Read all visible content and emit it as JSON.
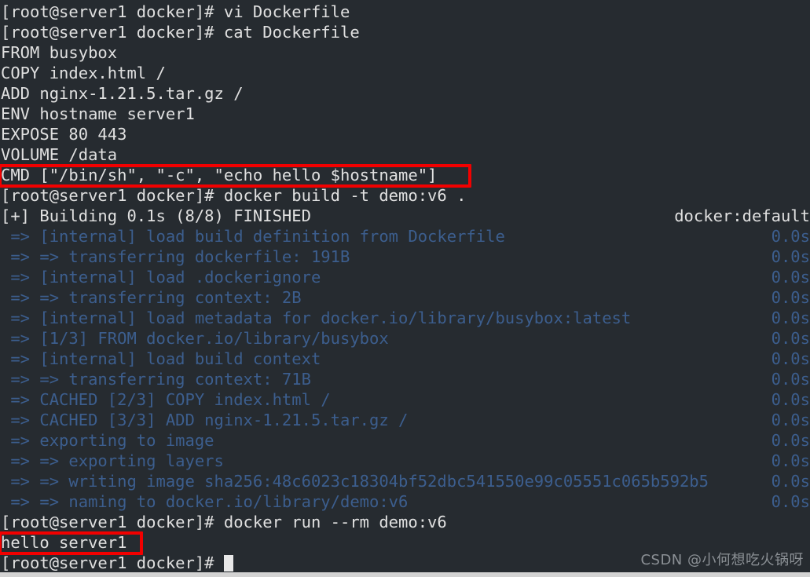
{
  "terminal": {
    "background_color": "#262b30",
    "foreground_color": "#e0e0e0",
    "build_output_color": "#3c5e8e",
    "highlight_color": "#f20000",
    "prompt": "[root@server1 docker]# ",
    "lines": [
      {
        "text": "[root@server1 docker]# vi Dockerfile",
        "color": "white",
        "duration": ""
      },
      {
        "text": "[root@server1 docker]# cat Dockerfile",
        "color": "white",
        "duration": ""
      },
      {
        "text": "FROM busybox",
        "color": "white",
        "duration": ""
      },
      {
        "text": "COPY index.html /",
        "color": "white",
        "duration": ""
      },
      {
        "text": "ADD nginx-1.21.5.tar.gz /",
        "color": "white",
        "duration": ""
      },
      {
        "text": "ENV hostname server1",
        "color": "white",
        "duration": ""
      },
      {
        "text": "EXPOSE 80 443",
        "color": "white",
        "duration": ""
      },
      {
        "text": "VOLUME /data",
        "color": "white",
        "duration": ""
      },
      {
        "text": "CMD [\"/bin/sh\", \"-c\", \"echo hello $hostname\"]",
        "color": "white",
        "duration": ""
      },
      {
        "text": "[root@server1 docker]# docker build -t demo:v6 .",
        "color": "white",
        "duration": ""
      },
      {
        "text": "[+] Building 0.1s (8/8) FINISHED",
        "color": "white",
        "duration": "docker:default"
      },
      {
        "text": " => [internal] load build definition from Dockerfile",
        "color": "blue",
        "duration": "0.0s"
      },
      {
        "text": " => => transferring dockerfile: 191B",
        "color": "blue",
        "duration": "0.0s"
      },
      {
        "text": " => [internal] load .dockerignore",
        "color": "blue",
        "duration": "0.0s"
      },
      {
        "text": " => => transferring context: 2B",
        "color": "blue",
        "duration": "0.0s"
      },
      {
        "text": " => [internal] load metadata for docker.io/library/busybox:latest",
        "color": "blue",
        "duration": "0.0s"
      },
      {
        "text": " => [1/3] FROM docker.io/library/busybox",
        "color": "blue",
        "duration": "0.0s"
      },
      {
        "text": " => [internal] load build context",
        "color": "blue",
        "duration": "0.0s"
      },
      {
        "text": " => => transferring context: 71B",
        "color": "blue",
        "duration": "0.0s"
      },
      {
        "text": " => CACHED [2/3] COPY index.html /",
        "color": "blue",
        "duration": "0.0s"
      },
      {
        "text": " => CACHED [3/3] ADD nginx-1.21.5.tar.gz /",
        "color": "blue",
        "duration": "0.0s"
      },
      {
        "text": " => exporting to image",
        "color": "blue",
        "duration": "0.0s"
      },
      {
        "text": " => => exporting layers",
        "color": "blue",
        "duration": "0.0s"
      },
      {
        "text": " => => writing image sha256:48c6023c18304bf52dbc541550e99c05551c065b592b5",
        "color": "blue",
        "duration": "0.0s"
      },
      {
        "text": " => => naming to docker.io/library/demo:v6",
        "color": "blue",
        "duration": "0.0s"
      },
      {
        "text": "[root@server1 docker]# docker run --rm demo:v6",
        "color": "white",
        "duration": ""
      },
      {
        "text": "hello server1",
        "color": "white",
        "duration": ""
      },
      {
        "text": "[root@server1 docker]# ",
        "color": "white",
        "duration": "",
        "cursor": true
      }
    ],
    "highlights": [
      {
        "id": "box-cmd",
        "target_line": 8,
        "label": "cmd-instruction-highlight"
      },
      {
        "id": "box-hello",
        "target_line": 26,
        "label": "container-output-highlight"
      }
    ]
  },
  "watermark": {
    "text": "CSDN @小何想吃火锅呀"
  }
}
